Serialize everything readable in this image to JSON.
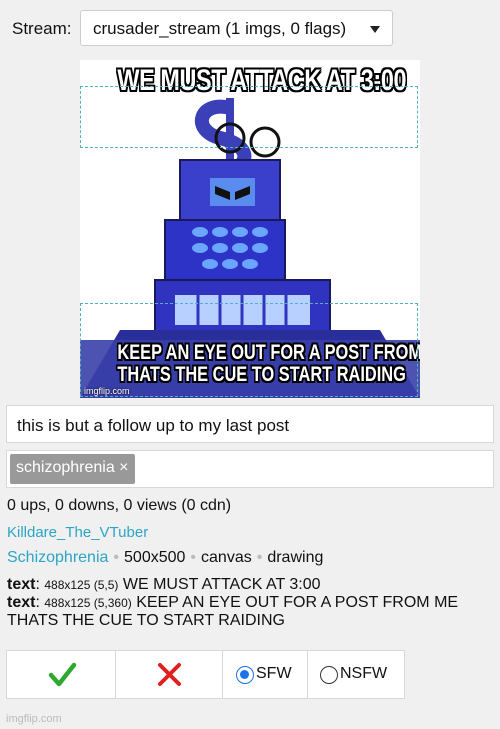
{
  "stream": {
    "label": "Stream:",
    "selected": "crusader_stream (1 imgs, 0 flags)"
  },
  "meme": {
    "top_text": "WE MUST ATTACK AT 3:00",
    "bottom_line1": "KEEP AN EYE OUT FOR A POST FROM ME",
    "bottom_line2": "THATS THE CUE TO START RAIDING",
    "watermark": "imgflip.com"
  },
  "post": {
    "title": "this is but a follow up to my last post",
    "tags": [
      "schizophrenia ×"
    ],
    "stats": "0 ups, 0 downs, 0 views (0 cdn)",
    "user": "Killdare_The_VTuber",
    "category": "Schizophrenia",
    "size": "500x500",
    "type": "canvas",
    "kind": "drawing"
  },
  "text_boxes": [
    {
      "label": "text",
      "dims": "488x125 (5,5)",
      "content": "WE MUST ATTACK AT 3:00"
    },
    {
      "label": "text",
      "dims": "488x125 (5,360)",
      "content": "KEEP AN EYE OUT FOR A POST FROM ME THATS THE CUE TO START RAIDING"
    }
  ],
  "actions": {
    "approve_icon": "check-icon",
    "reject_icon": "x-icon",
    "sfw_label": "SFW",
    "nsfw_label": "NSFW",
    "sfw_checked": true
  },
  "footer": "imgflip.com",
  "colors": {
    "accent": "#2aa6c4",
    "approve": "#2ea82e",
    "reject": "#e02020"
  }
}
